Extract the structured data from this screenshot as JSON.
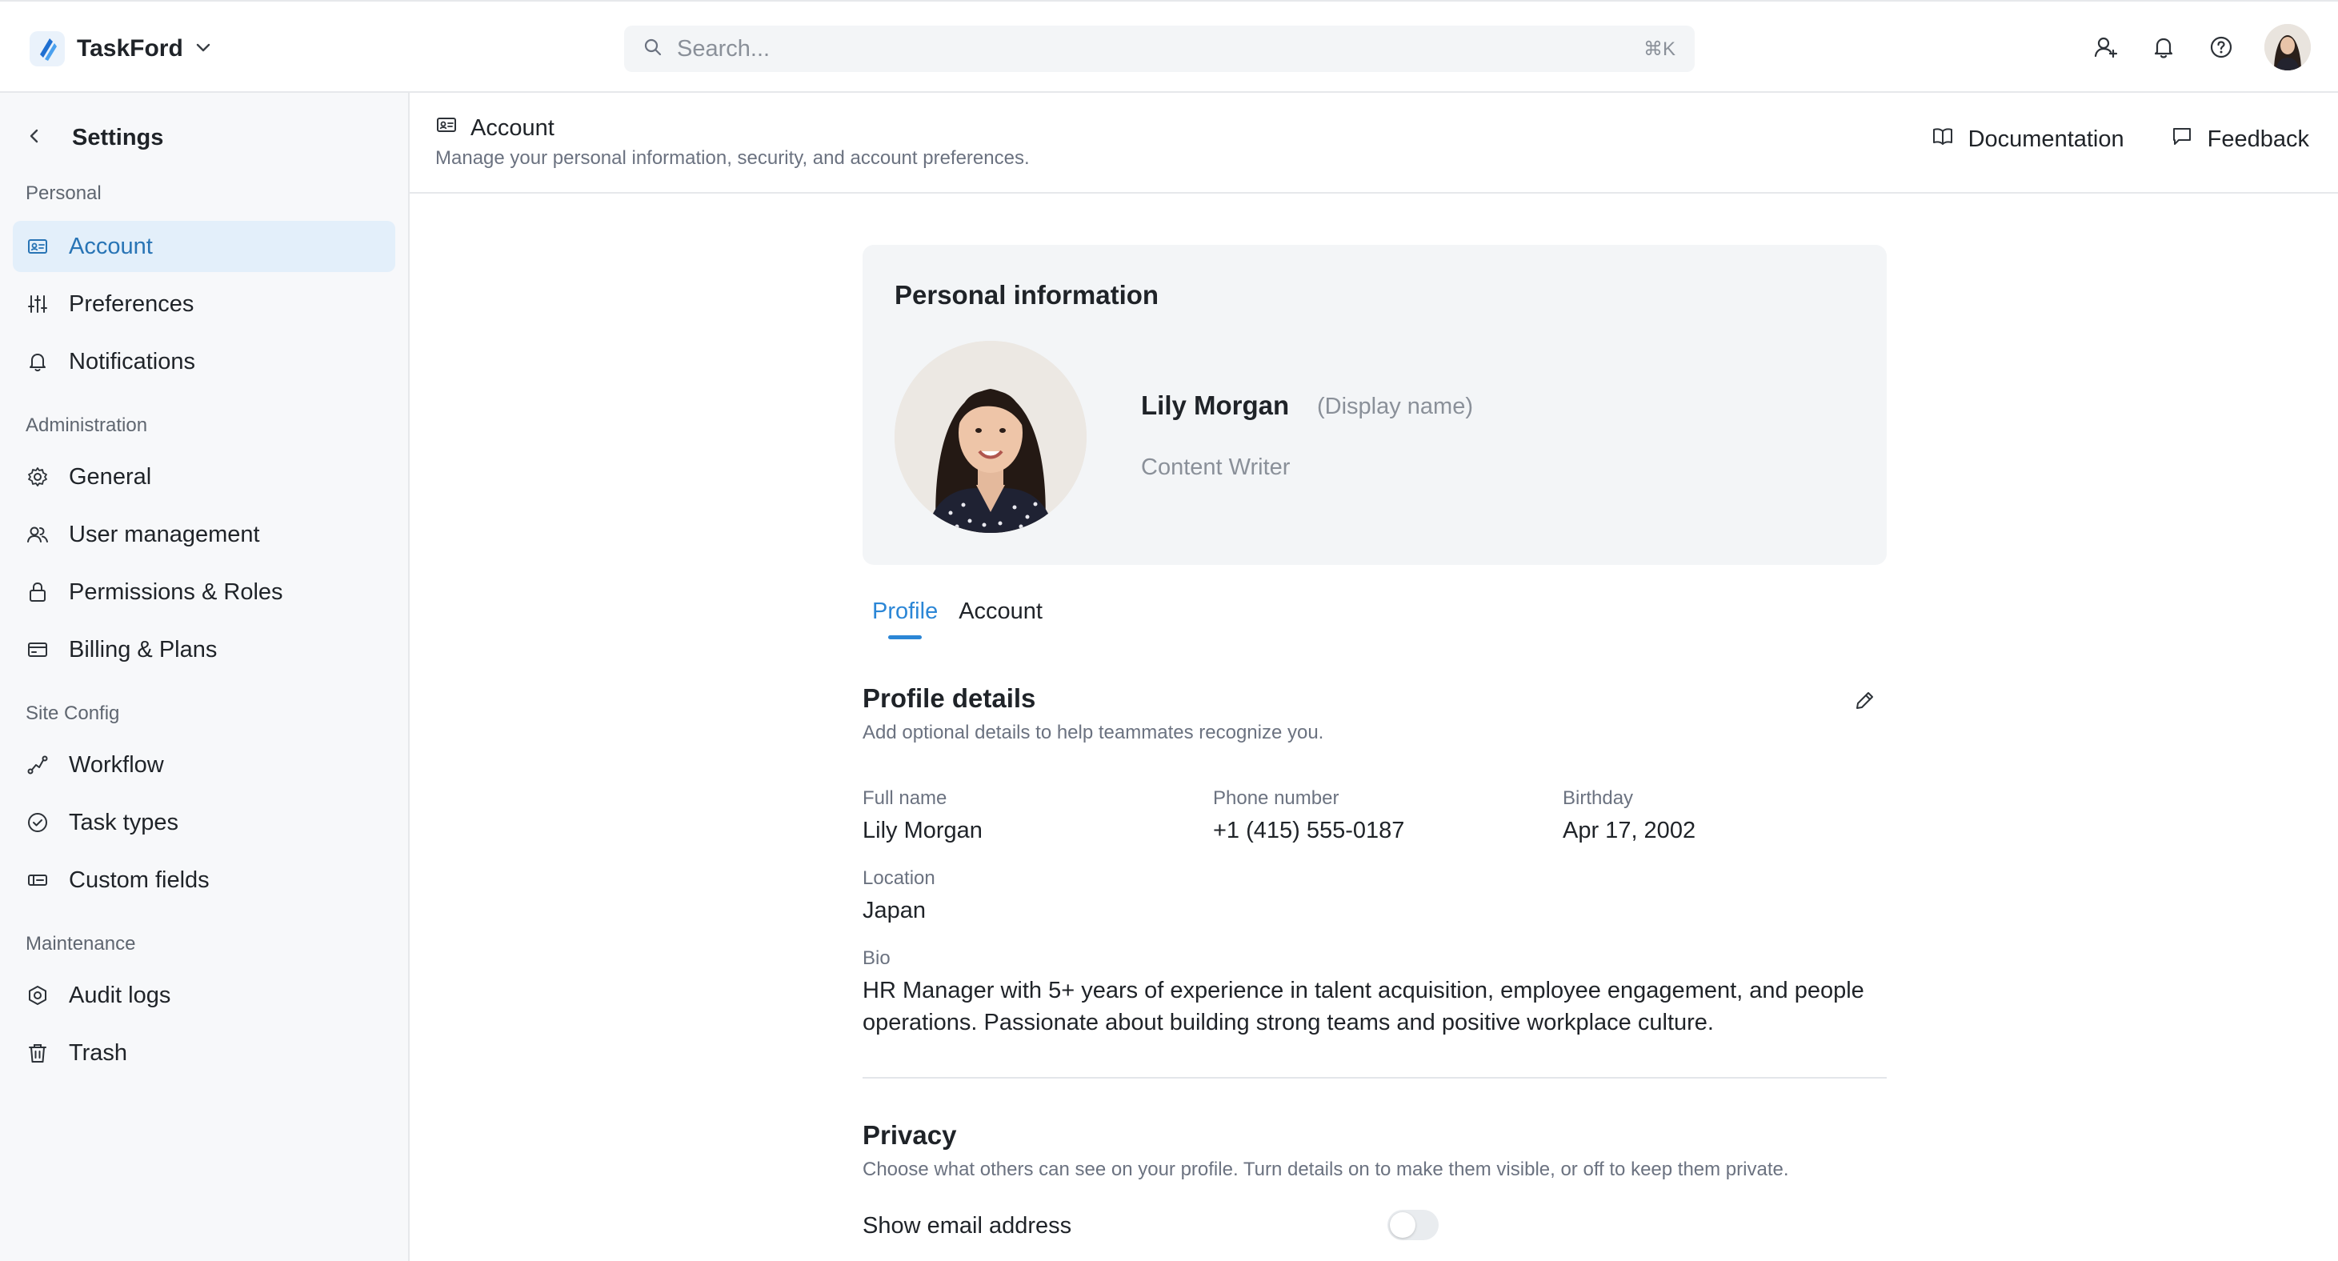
{
  "app": {
    "name": "TaskFord"
  },
  "search": {
    "placeholder": "Search...",
    "shortcut": "⌘K"
  },
  "sidebar": {
    "title": "Settings",
    "groups": [
      {
        "label": "Personal",
        "items": [
          "Account",
          "Preferences",
          "Notifications"
        ]
      },
      {
        "label": "Administration",
        "items": [
          "General",
          "User management",
          "Permissions & Roles",
          "Billing & Plans"
        ]
      },
      {
        "label": "Site Config",
        "items": [
          "Workflow",
          "Task types",
          "Custom fields"
        ]
      },
      {
        "label": "Maintenance",
        "items": [
          "Audit logs",
          "Trash"
        ]
      }
    ],
    "active_item": "Account"
  },
  "page_header": {
    "title": "Account",
    "subtitle": "Manage your personal information, security, and account preferences.",
    "documentation_label": "Documentation",
    "feedback_label": "Feedback"
  },
  "personal_info": {
    "title": "Personal information",
    "name": "Lily Morgan",
    "display_name_hint": "(Display name)",
    "role": "Content Writer"
  },
  "tabs": {
    "items": [
      "Profile",
      "Account"
    ],
    "active": "Profile"
  },
  "profile_details": {
    "title": "Profile details",
    "subtitle": "Add optional details to help teammates recognize you.",
    "full_name_label": "Full name",
    "full_name": "Lily Morgan",
    "phone_label": "Phone number",
    "phone": "+1 (415) 555-0187",
    "birthday_label": "Birthday",
    "birthday": "Apr 17, 2002",
    "location_label": "Location",
    "location": "Japan",
    "bio_label": "Bio",
    "bio": "HR Manager with 5+ years of experience in talent acquisition, employee engagement, and people operations. Passionate about building strong teams and positive workplace culture."
  },
  "privacy": {
    "title": "Privacy",
    "subtitle": "Choose what others can see on your profile. Turn details on to make them visible, or off to keep them private.",
    "show_email_label": "Show email address",
    "show_email_enabled": false
  },
  "colors": {
    "accent": "#2b86d6",
    "active_bg": "#e3effa",
    "sidebar_bg": "#f7f8fa"
  }
}
